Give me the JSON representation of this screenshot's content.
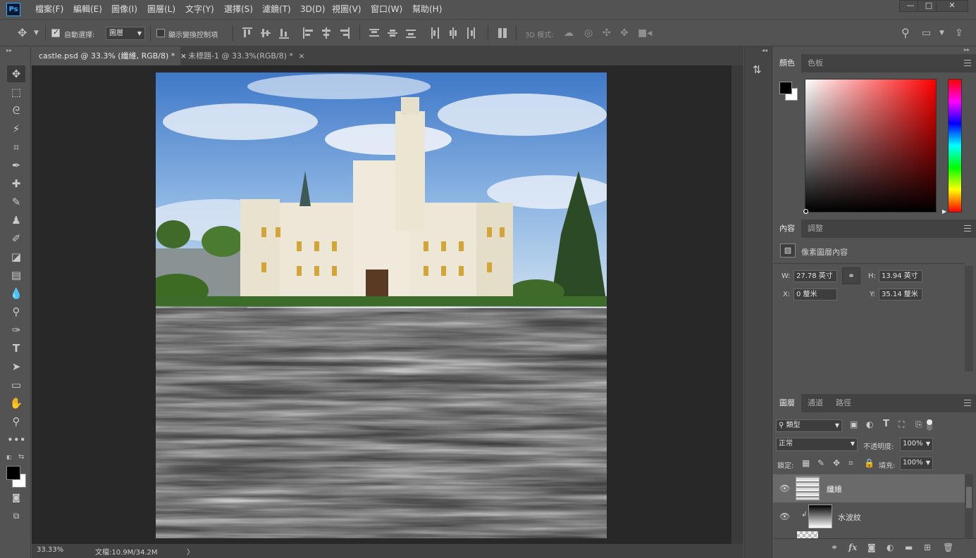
{
  "app": {
    "logo": "Ps"
  },
  "menu": [
    "檔案(F)",
    "編輯(E)",
    "圖像(I)",
    "圖層(L)",
    "文字(Y)",
    "選擇(S)",
    "濾鏡(T)",
    "3D(D)",
    "視圖(V)",
    "窗口(W)",
    "幫助(H)"
  ],
  "window_controls": {
    "minimize": "—",
    "maximize": "□",
    "close": "✕"
  },
  "options": {
    "auto_select_label": "自動選擇:",
    "auto_select_checked": true,
    "auto_select_target": "圖層",
    "show_transform_label": "顯示變換控制項",
    "show_transform_checked": false,
    "mode_3d_label": "3D 模式:"
  },
  "tabs": [
    {
      "label": "castle.psd @ 33.3% (纖維, RGB/8) *",
      "close": "×",
      "active": true
    },
    {
      "label": "未標題-1 @ 33.3%(RGB/8) *",
      "close": "×",
      "active": false
    }
  ],
  "status": {
    "zoom": "33.33%",
    "doc_size": "文檔:10.9M/34.2M",
    "arrow": "〉"
  },
  "color_panel": {
    "tabs": [
      "顏色",
      "色板"
    ],
    "active_tab": "顏色",
    "foreground": "#000000",
    "background": "#ffffff",
    "hue_color": "#ff0000"
  },
  "properties_panel": {
    "tabs": [
      "內容",
      "調整"
    ],
    "active_tab": "內容",
    "title": "像素圖層內容",
    "w_label": "W:",
    "w_value": "27.78 英寸",
    "h_label": "H:",
    "h_value": "13.94 英寸",
    "x_label": "X:",
    "x_value": "0 釐米",
    "y_label": "Y:",
    "y_value": "35.14 釐米"
  },
  "layers_panel": {
    "tabs": [
      "圖層",
      "通道",
      "路徑"
    ],
    "active_tab": "圖層",
    "filter_kind": "類型",
    "blend_mode": "正常",
    "opacity_label": "不透明度:",
    "opacity_value": "100%",
    "lock_label": "鎖定:",
    "fill_label": "填充:",
    "fill_value": "100%",
    "layers": [
      {
        "name": "纖維",
        "visible": true,
        "selected": true,
        "clipped": false
      },
      {
        "name": "水波紋",
        "visible": true,
        "selected": false,
        "clipped": true
      }
    ]
  }
}
